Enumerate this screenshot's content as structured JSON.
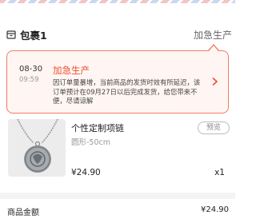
{
  "package": {
    "title": "包裹1",
    "status": "加急生产"
  },
  "notice": {
    "date": "08-30",
    "time": "09:59",
    "heading": "加急生产",
    "body": "因订单量暴增，当前商品的发货时效有所延迟，该订单预计在09月27日以后完成发货，给您带来不便，尽请谅解"
  },
  "product": {
    "name": "个性定制项链",
    "spec": "圆形-50cm",
    "preview_label": "预览",
    "price": "¥24.90",
    "quantity": "x1"
  },
  "summary": {
    "amount_label": "商品金额",
    "amount_value": "¥24.90"
  },
  "colors": {
    "accent": "#ee4d2d",
    "notice_border": "#f07d65",
    "notice_bg": "#fff6f3"
  },
  "icons": {
    "package": "package-icon",
    "chevron": "chevron-right-icon"
  }
}
